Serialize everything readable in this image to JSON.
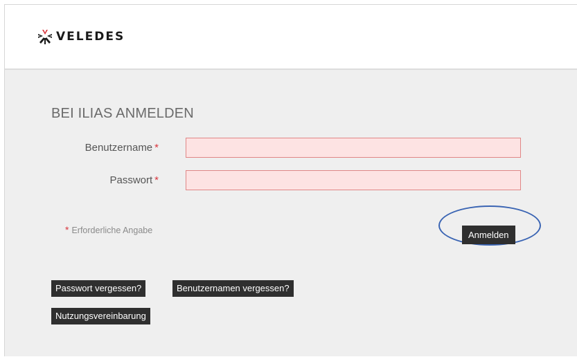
{
  "header": {
    "logo_text": "VELEDES",
    "logo_icon": "veledes-snowflake-icon"
  },
  "login": {
    "title": "BEI ILIAS ANMELDEN",
    "username_label": "Benutzername",
    "password_label": "Passwort",
    "required_marker": "*",
    "username_value": "",
    "password_value": "",
    "required_note": "Erforderliche Angabe",
    "submit_label": "Anmelden"
  },
  "links": {
    "forgot_password": "Passwort vergessen?",
    "forgot_username": "Benutzernamen vergessen?",
    "terms": "Nutzungsvereinbarung"
  },
  "colors": {
    "required": "#d9363e",
    "input_bg": "#fde3e3",
    "input_border": "#e08686",
    "button_bg": "#2f2f2f",
    "highlight": "#3a64b3"
  }
}
